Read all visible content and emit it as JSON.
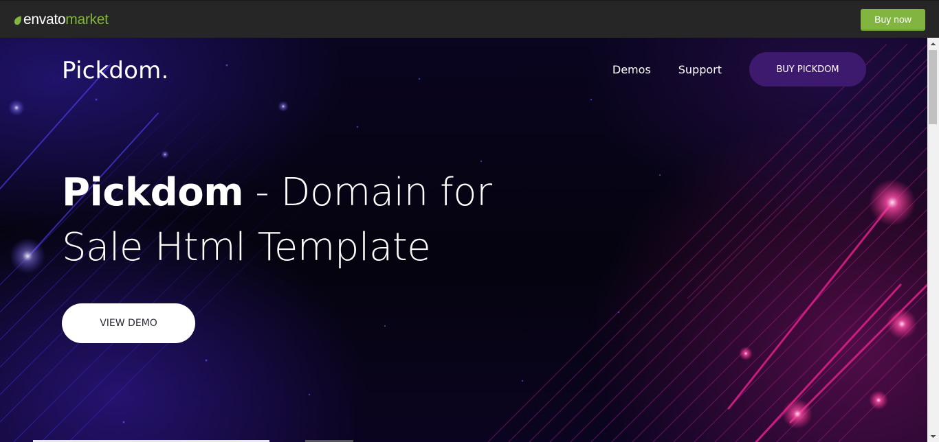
{
  "envato": {
    "logo_envato": "envato",
    "logo_market": "market",
    "buy_label": "Buy now",
    "accent_color": "#82b540"
  },
  "site": {
    "brand": "Pickdom.",
    "nav": [
      {
        "label": "Demos"
      },
      {
        "label": "Support"
      }
    ],
    "buy_label": "BUY PICKDOM",
    "buy_color": "#3e1a6e"
  },
  "hero": {
    "title_strong": "Pickdom",
    "title_rest": " - Domain for",
    "title_line2": "Sale Html Template",
    "cta_label": "VIEW DEMO"
  },
  "icons": {
    "envato_logo": "leaf-icon",
    "scroll_up": "chevron-up-icon",
    "scroll_down": "chevron-down-icon"
  }
}
